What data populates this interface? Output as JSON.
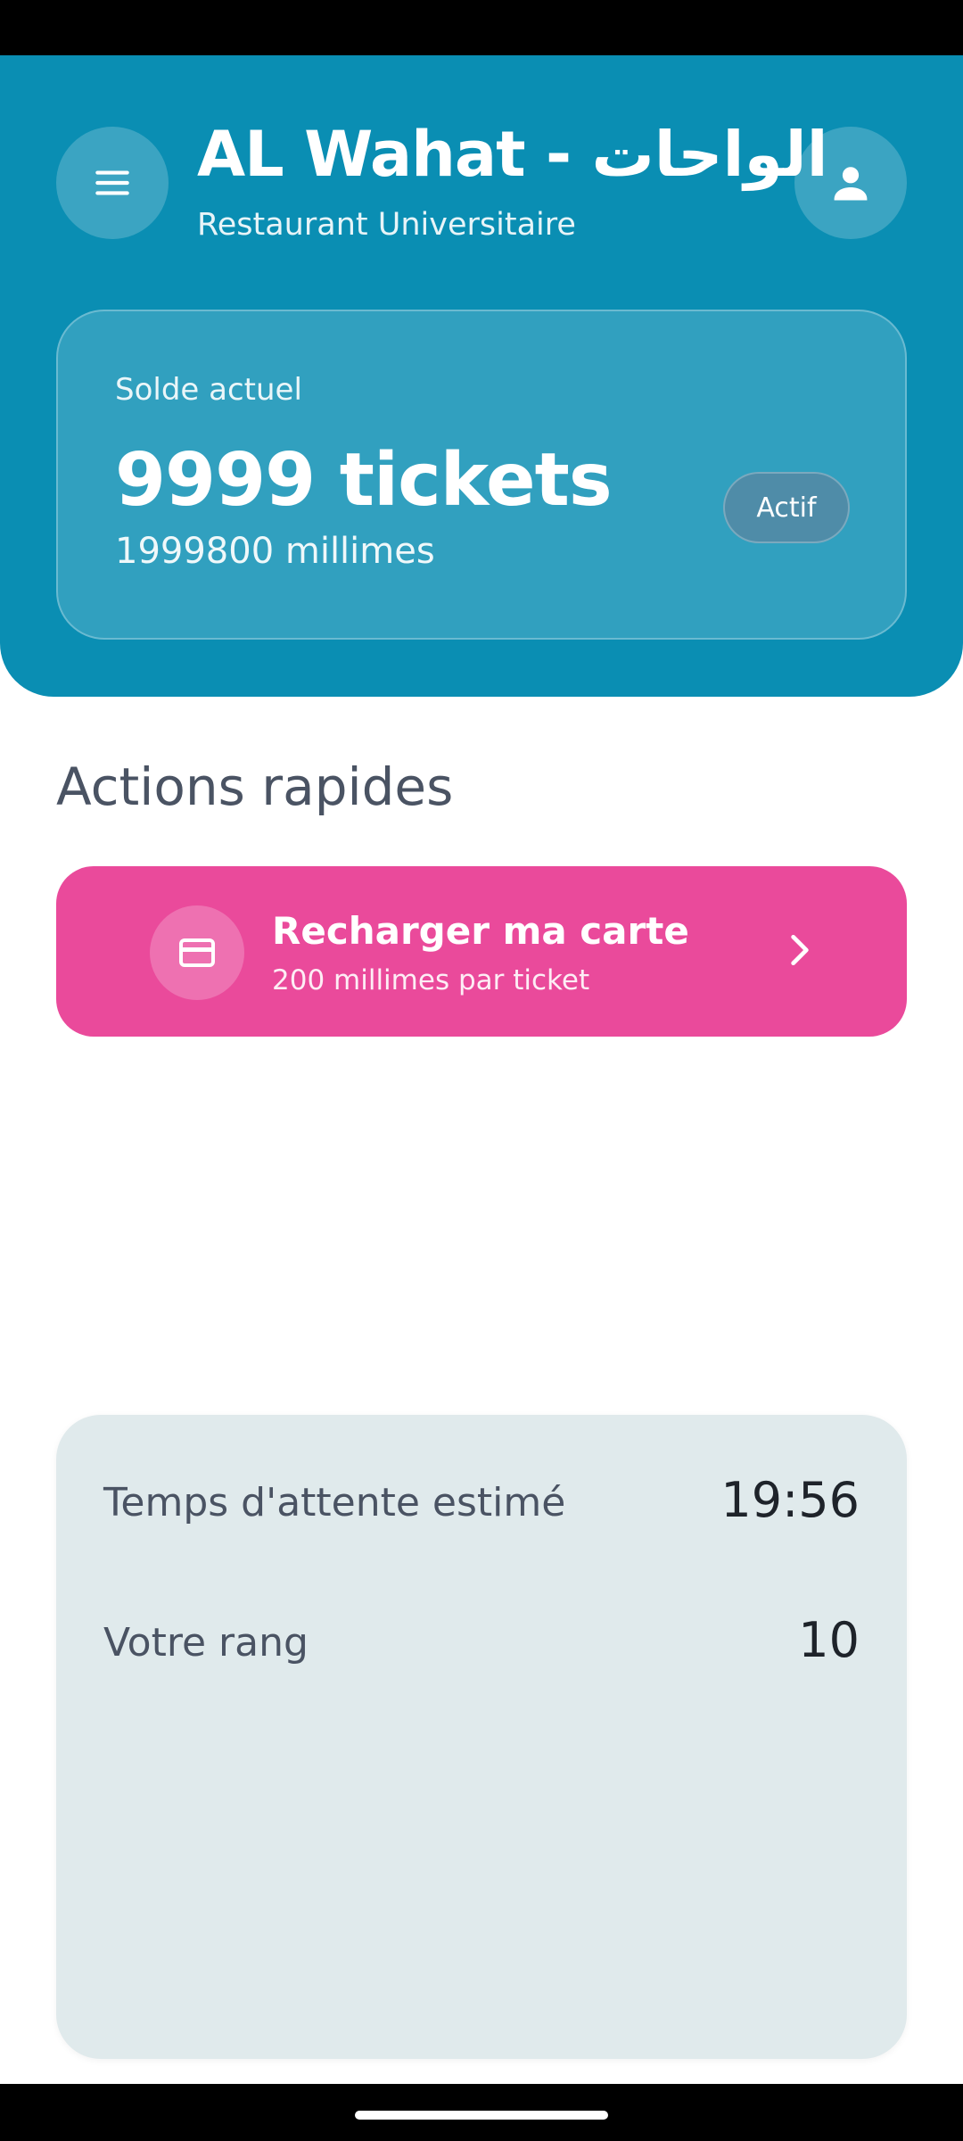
{
  "header": {
    "title": "AL Wahat - الواحات",
    "subtitle": "Restaurant Universitaire",
    "menu_icon": "hamburger-menu-icon",
    "profile_icon": "person-icon",
    "background_color": "#0a8eb3"
  },
  "balance": {
    "label": "Solde actuel",
    "tickets": "9999 tickets",
    "millimes": "1999800 millimes",
    "status": "Actif"
  },
  "quick_actions": {
    "title": "Actions rapides",
    "recharge": {
      "title": "Recharger ma carte",
      "subtitle": "200 millimes par ticket",
      "icon": "credit-card-icon",
      "chevron_icon": "chevron-right-icon",
      "color": "#ea4a9b"
    }
  },
  "queue": {
    "wait_label": "Temps d'attente estimé",
    "wait_value": "19:56",
    "rank_label": "Votre rang",
    "rank_value": "10"
  }
}
